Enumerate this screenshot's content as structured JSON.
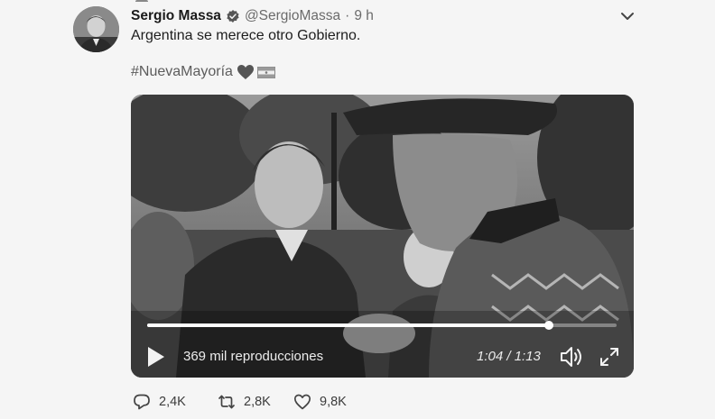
{
  "tweet": {
    "display_name": "Sergio Massa",
    "handle": "@SergioMassa",
    "separator": "·",
    "time": "9 h",
    "text": "Argentina se merece otro Gobierno.",
    "hashtag": "#NuevaMayoría",
    "emoji_icons": [
      "heart-icon",
      "flag-icon"
    ]
  },
  "video": {
    "views": "369 mil reproducciones",
    "timecode": "1:04 / 1:13",
    "progress": 0.855
  },
  "actions": {
    "reply_count": "2,4K",
    "retweet_count": "2,8K",
    "like_count": "9,8K"
  }
}
